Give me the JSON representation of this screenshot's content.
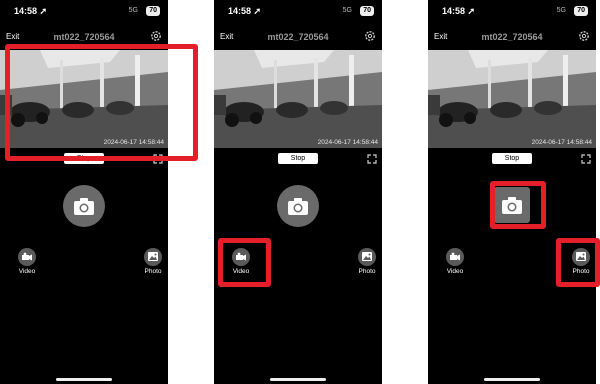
{
  "status": {
    "time": "14:58 ➚",
    "network": "5G",
    "battery": "70"
  },
  "header": {
    "exit_label": "Exit",
    "device_title": "mt022_720564"
  },
  "video": {
    "timestamp": "2024-06-17 14:58:44"
  },
  "controls": {
    "stop_label": "Stop",
    "video_label": "Video",
    "photo_label": "Photo"
  },
  "highlight_color": "#e51f2a",
  "icons": [
    "gear-icon",
    "fullscreen-icon",
    "camera-icon",
    "video-camera-icon",
    "photo-gallery-icon"
  ]
}
